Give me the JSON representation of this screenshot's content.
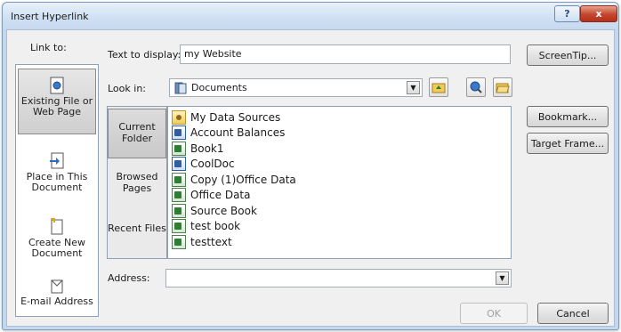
{
  "window": {
    "title": "Insert Hyperlink",
    "help_glyph": "?",
    "close_glyph": "x"
  },
  "link_to": {
    "label": "Link to:",
    "items": [
      {
        "label": "Existing File or Web Page",
        "selected": true,
        "icon": "globe-page-icon"
      },
      {
        "label": "Place in This Document",
        "selected": false,
        "icon": "document-place-icon"
      },
      {
        "label": "Create New Document",
        "selected": false,
        "icon": "new-document-icon"
      },
      {
        "label": "E-mail Address",
        "selected": false,
        "icon": "email-icon"
      }
    ]
  },
  "text_to_display": {
    "label": "Text to display:",
    "value": "my Website"
  },
  "look_in": {
    "label": "Look in:",
    "value": "Documents"
  },
  "places": [
    {
      "label": "Current Folder",
      "selected": true
    },
    {
      "label": "Browsed Pages",
      "selected": false
    },
    {
      "label": "Recent Files",
      "selected": false
    }
  ],
  "files": [
    {
      "name": "My Data Sources",
      "icon": "folder"
    },
    {
      "name": "Account Balances",
      "icon": "db"
    },
    {
      "name": "Book1",
      "icon": "excel"
    },
    {
      "name": "CoolDoc",
      "icon": "doc"
    },
    {
      "name": "Copy (1)Office Data",
      "icon": "excel"
    },
    {
      "name": "Office Data",
      "icon": "excel"
    },
    {
      "name": "Source Book",
      "icon": "excel"
    },
    {
      "name": "test book",
      "icon": "excel"
    },
    {
      "name": "testtext",
      "icon": "excel"
    }
  ],
  "address": {
    "label": "Address:",
    "value": ""
  },
  "buttons": {
    "screentip": "ScreenTip...",
    "bookmark": "Bookmark...",
    "target_frame": "Target Frame...",
    "ok": "OK",
    "cancel": "Cancel"
  },
  "colors": {
    "accent": "#7f9db9",
    "panel": "#f0f0f0",
    "close": "#c4452c"
  }
}
